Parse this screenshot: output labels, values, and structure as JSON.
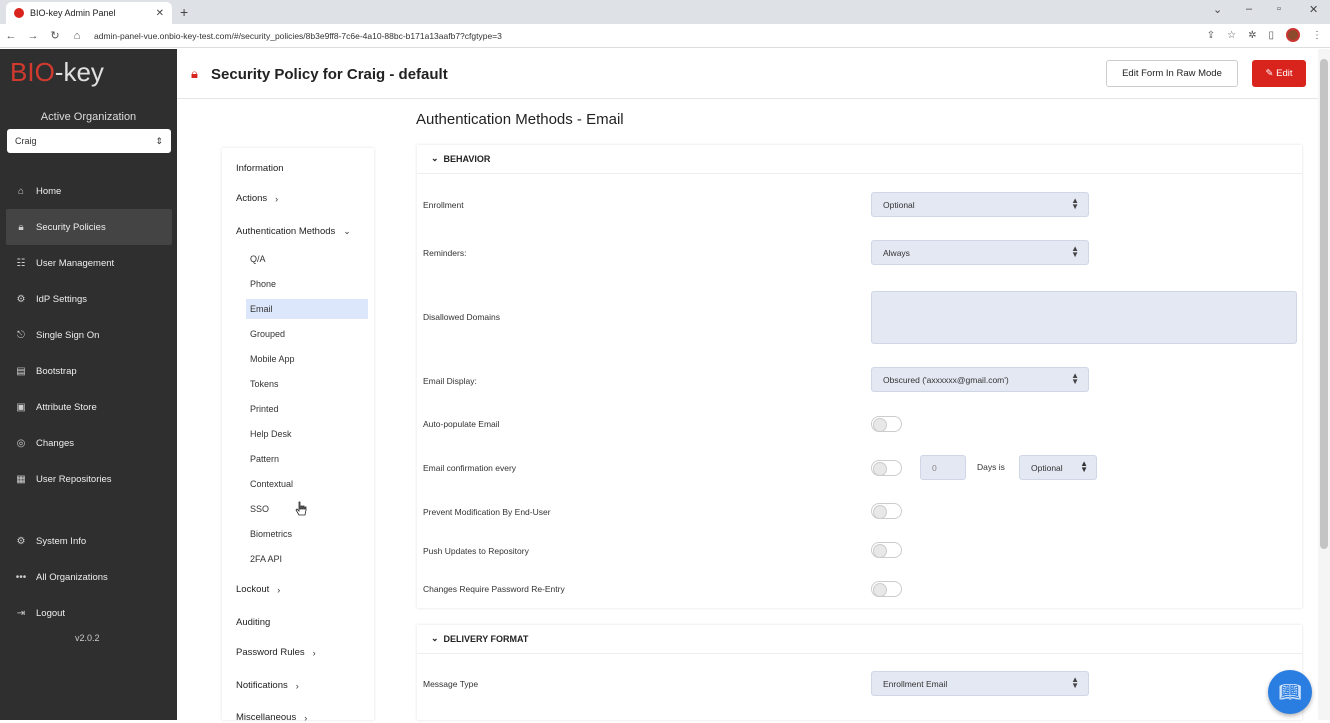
{
  "browser": {
    "tab_title": "BIO-key Admin Panel",
    "url": "admin-panel-vue.onbio-key-test.com/#/security_policies/8b3e9ff8-7c6e-4a10-88bc-b171a13aafb7?cfgtype=3"
  },
  "sidebar": {
    "brand": {
      "prefix": "BIO",
      "suffix": "-key"
    },
    "active_org_label": "Active Organization",
    "org_value": "Craig",
    "items": [
      {
        "label": "Home",
        "icon": "home-icon"
      },
      {
        "label": "Security Policies",
        "icon": "lock-icon"
      },
      {
        "label": "User Management",
        "icon": "users-icon"
      },
      {
        "label": "IdP Settings",
        "icon": "settings-icon"
      },
      {
        "label": "Single Sign On",
        "icon": "sso-icon"
      },
      {
        "label": "Bootstrap",
        "icon": "bootstrap-icon"
      },
      {
        "label": "Attribute Store",
        "icon": "database-icon"
      },
      {
        "label": "Changes",
        "icon": "changes-icon"
      },
      {
        "label": "User Repositories",
        "icon": "repository-icon"
      }
    ],
    "bottom_items": [
      {
        "label": "System Info",
        "icon": "info-icon"
      },
      {
        "label": "All Organizations",
        "icon": "ellipsis-icon"
      },
      {
        "label": "Logout",
        "icon": "logout-icon"
      }
    ],
    "version": "v2.0.2"
  },
  "header": {
    "title": "Security Policy for Craig - default",
    "raw_button": "Edit Form In Raw Mode",
    "edit_button": "Edit"
  },
  "section_nav": {
    "information": "Information",
    "actions": "Actions",
    "auth_methods": "Authentication Methods",
    "sub_items": [
      "Q/A",
      "Phone",
      "Email",
      "Grouped",
      "Mobile App",
      "Tokens",
      "Printed",
      "Help Desk",
      "Pattern",
      "Contextual",
      "SSO",
      "Biometrics",
      "2FA API"
    ],
    "lockout": "Lockout",
    "auditing": "Auditing",
    "password_rules": "Password Rules",
    "notifications": "Notifications",
    "miscellaneous": "Miscellaneous"
  },
  "main": {
    "title": "Authentication Methods - Email",
    "behavior": {
      "heading": "BEHAVIOR",
      "enrollment_label": "Enrollment",
      "enrollment_value": "Optional",
      "reminders_label": "Reminders:",
      "reminders_value": "Always",
      "disallowed_label": "Disallowed Domains",
      "display_label": "Email Display:",
      "display_value": "Obscured ('axxxxxx@gmail.com')",
      "autopopulate_label": "Auto-populate Email",
      "confirm_label": "Email confirmation every",
      "confirm_days": "0",
      "days_is": "Days is",
      "confirm_mode": "Optional",
      "prevent_label": "Prevent Modification By End-User",
      "push_label": "Push Updates to Repository",
      "reentry_label": "Changes Require Password Re-Entry"
    },
    "delivery": {
      "heading": "DELIVERY FORMAT",
      "message_type_label": "Message Type",
      "message_type_value": "Enrollment Email"
    }
  },
  "colors": {
    "accent": "#d9241d",
    "sidebar_bg": "#2f2f2f",
    "select_bg": "#e4e8f3",
    "fab": "#2a7de1"
  }
}
